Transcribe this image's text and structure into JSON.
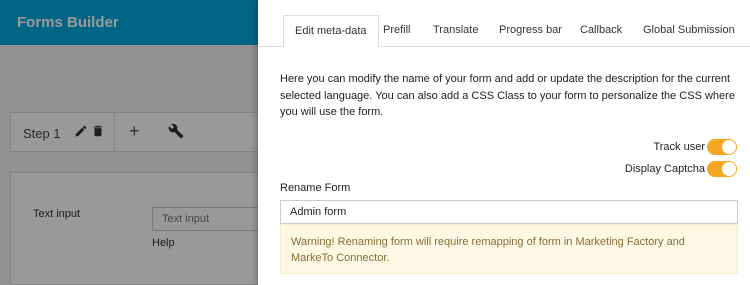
{
  "app": {
    "title": "Forms Builder",
    "step_label": "Step 1",
    "add_step_symbol": "+",
    "field_label": "Text input",
    "field_placeholder": "Text input",
    "field_help": "Help"
  },
  "panel": {
    "tabs": [
      {
        "label": "Edit meta-data",
        "active": true
      },
      {
        "label": "Prefill",
        "active": false
      },
      {
        "label": "Translate",
        "active": false
      },
      {
        "label": "Progress bar",
        "active": false
      },
      {
        "label": "Callback",
        "active": false
      },
      {
        "label": "Global Submission",
        "active": false
      }
    ],
    "description": "Here you can modify the name of your form and add or update the description for the current selected language. You can also add a CSS Class to your form to personalize the CSS where you will use the form.",
    "toggles": [
      {
        "label": "Track user",
        "on": true
      },
      {
        "label": "Display Captcha",
        "on": true
      }
    ],
    "rename": {
      "label": "Rename Form",
      "value": "Admin form"
    },
    "warning": "Warning! Renaming form will require remapping of form in Marketing Factory and MarkeTo Connector."
  },
  "colors": {
    "header_blue": "#02a8e0",
    "toggle_orange": "#f5a623",
    "warning_bg": "#fcf8e3",
    "warning_text": "#8a6d3b"
  },
  "icons": {
    "edit": "pencil-icon",
    "delete": "trash-icon",
    "add": "plus-icon",
    "settings": "wrench-icon"
  }
}
